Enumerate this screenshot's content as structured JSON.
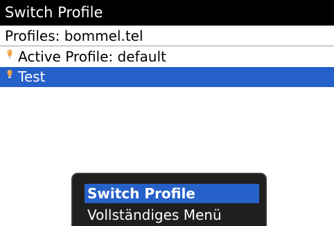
{
  "window": {
    "title": "Switch Profile"
  },
  "header": {
    "label": "Profiles: bommel.tel"
  },
  "profiles": [
    {
      "label": "Active Profile: default",
      "icon": "profile-bulb-icon",
      "selected": false
    },
    {
      "label": "Test",
      "icon": "profile-bulb-icon",
      "selected": true
    }
  ],
  "popup_menu": {
    "items": [
      {
        "label": "Switch Profile",
        "highlighted": true
      },
      {
        "label": "Vollständiges Menü",
        "highlighted": false
      }
    ]
  },
  "colors": {
    "titlebar_bg": "#000000",
    "selection": "#2561c9",
    "menu_bg": "#1f1f1f",
    "bulb": "#f0a040"
  }
}
